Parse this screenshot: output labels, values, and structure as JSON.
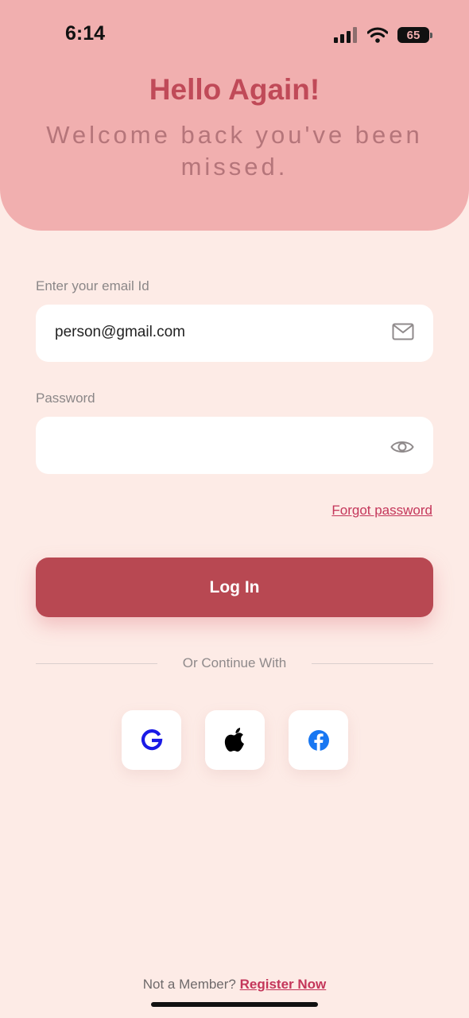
{
  "status_bar": {
    "time": "6:14",
    "battery": "65"
  },
  "header": {
    "title": "Hello Again!",
    "subtitle": "Welcome back you've been missed."
  },
  "form": {
    "email_label": "Enter your email Id",
    "email_value": "person@gmail.com",
    "password_label": "Password",
    "password_value": "",
    "forgot_label": "Forgot password",
    "login_label": "Log In"
  },
  "social": {
    "divider_text": "Or Continue With",
    "icons": [
      "google-icon",
      "apple-icon",
      "facebook-icon"
    ]
  },
  "footer": {
    "prompt": "Not a Member?",
    "register_label": "Register Now"
  },
  "colors": {
    "header_bg": "#f1afaf",
    "page_bg": "#fdebe6",
    "primary": "#b84852",
    "link": "#c4365a"
  }
}
